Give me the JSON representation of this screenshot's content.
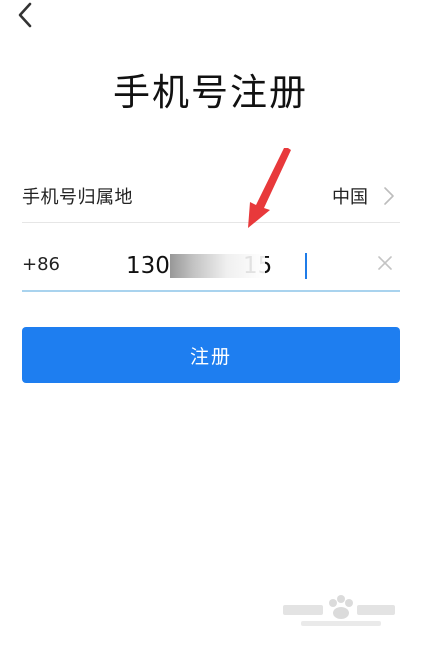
{
  "header": {
    "back_icon": "chevron-left-icon",
    "title": "手机号注册"
  },
  "region": {
    "label": "手机号归属地",
    "value": "中国",
    "chevron_icon": "chevron-right-icon"
  },
  "phone": {
    "prefix": "+86",
    "value": "130          15",
    "clear_icon": "close-icon"
  },
  "actions": {
    "register_label": "注册"
  },
  "colors": {
    "accent": "#1e7ef0",
    "annotation_arrow": "#e8393b",
    "active_underline": "#a9d3ee"
  }
}
